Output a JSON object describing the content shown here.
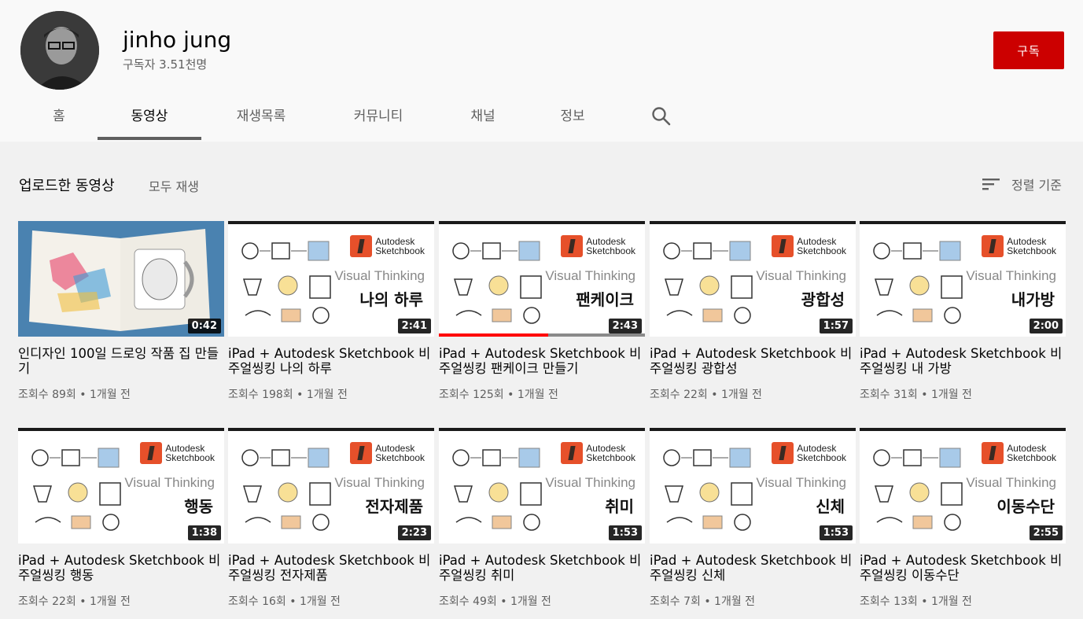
{
  "channel": {
    "name": "jinho jung",
    "subscribers": "구독자 3.51천명",
    "subscribe_label": "구독"
  },
  "tabs": [
    {
      "label": "홈"
    },
    {
      "label": "동영상"
    },
    {
      "label": "재생목록"
    },
    {
      "label": "커뮤니티"
    },
    {
      "label": "채널"
    },
    {
      "label": "정보"
    }
  ],
  "active_tab": "동영상",
  "section": {
    "title": "업로드한 동영상",
    "play_all": "모두 재생",
    "sort_label": "정렬 기준"
  },
  "thumb_text": {
    "brand_line1": "Autodesk",
    "brand_line2": "Sketchbook",
    "visual_thinking": "Visual Thinking"
  },
  "videos": [
    {
      "title": "인디자인 100일 드로잉 작품 집 만들기",
      "meta": "조회수 89회 • 1개월 전",
      "duration": "0:42",
      "thumb_word": "",
      "progress": 0
    },
    {
      "title": "iPad + Autodesk Sketchbook 비주얼씽킹 나의 하루",
      "meta": "조회수 198회 • 1개월 전",
      "duration": "2:41",
      "thumb_word": "나의 하루",
      "progress": 0
    },
    {
      "title": "iPad + Autodesk Sketchbook 비주얼씽킹 팬케이크 만들기",
      "meta": "조회수 125회 • 1개월 전",
      "duration": "2:43",
      "thumb_word": "팬케이크",
      "progress": 0.53
    },
    {
      "title": "iPad + Autodesk Sketchbook 비주얼씽킹 광합성",
      "meta": "조회수 22회 • 1개월 전",
      "duration": "1:57",
      "thumb_word": "광합성",
      "progress": 0
    },
    {
      "title": "iPad + Autodesk Sketchbook 비주얼씽킹 내 가방",
      "meta": "조회수 31회 • 1개월 전",
      "duration": "2:00",
      "thumb_word": "내가방",
      "progress": 0
    },
    {
      "title": "iPad + Autodesk Sketchbook 비주얼씽킹 행동",
      "meta": "조회수 22회 • 1개월 전",
      "duration": "1:38",
      "thumb_word": "행동",
      "progress": 0
    },
    {
      "title": "iPad + Autodesk Sketchbook 비주얼씽킹 전자제품",
      "meta": "조회수 16회 • 1개월 전",
      "duration": "2:23",
      "thumb_word": "전자제품",
      "progress": 0
    },
    {
      "title": "iPad + Autodesk Sketchbook 비주얼씽킹 취미",
      "meta": "조회수 49회 • 1개월 전",
      "duration": "1:53",
      "thumb_word": "취미",
      "progress": 0
    },
    {
      "title": "iPad + Autodesk Sketchbook 비주얼씽킹 신체",
      "meta": "조회수 7회 • 1개월 전",
      "duration": "1:53",
      "thumb_word": "신체",
      "progress": 0
    },
    {
      "title": "iPad + Autodesk Sketchbook 비주얼씽킹 이동수단",
      "meta": "조회수 13회 • 1개월 전",
      "duration": "2:55",
      "thumb_word": "이동수단",
      "progress": 0
    }
  ],
  "colors": {
    "subscribe": "#cc0000",
    "progress": "#ff0000",
    "brand": "#e6502a"
  }
}
